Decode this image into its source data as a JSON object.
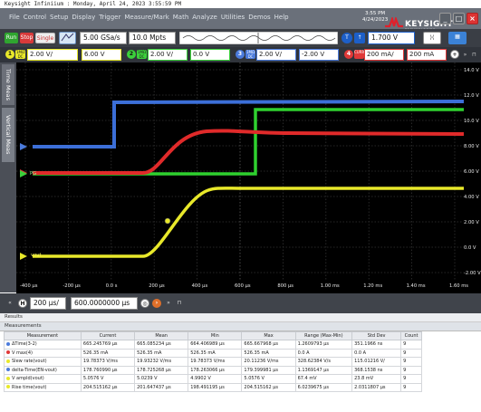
{
  "title_line": "Keysight Infiniium : Monday, April 24, 2023 3:55:59 PM",
  "menu": [
    "File",
    "Control",
    "Setup",
    "Display",
    "Trigger",
    "Measure/Mark",
    "Math",
    "Analyze",
    "Utilities",
    "Demos",
    "Help"
  ],
  "clock": {
    "time": "3:55 PM",
    "date": "4/24/2023"
  },
  "brand": {
    "name": "KEYSIGHT",
    "sub": "TECHNOLOGIES"
  },
  "acq": {
    "run": "Run",
    "stop": "Stop",
    "single": "Single",
    "sample_rate": "5.00 GSa/s",
    "memory": "10.0 Mpts",
    "trigger_level": "1.700 V"
  },
  "channels": [
    {
      "id": "1",
      "scale": "2.00 V/",
      "offset": "6.00 V",
      "color": "#e8e82a"
    },
    {
      "id": "2",
      "scale": "2.00 V/",
      "offset": "0.0 V",
      "color": "#3bd13b"
    },
    {
      "id": "3",
      "scale": "2.00 V/",
      "offset": "-2.00 V",
      "color": "#4b7bdc"
    },
    {
      "id": "4",
      "scale": "200 mA/",
      "offset": "200 mA",
      "color": "#e03838"
    }
  ],
  "sidebar": {
    "tab1": "Time Meas",
    "tab2": "Vertical Meas"
  },
  "y_ticks": [
    "14.0 V",
    "12.0 V",
    "10.0 V",
    "8.00 V",
    "6.00 V",
    "4.00 V",
    "2.00 V",
    "0.0 V",
    "-2.00 V"
  ],
  "x_ticks": [
    "-400 µs",
    "-200 µs",
    "0.0 s",
    "200 µs",
    "400 µs",
    "600 µs",
    "800 µs",
    "1.00 ms",
    "1.20 ms",
    "1.40 ms",
    "1.60 ms"
  ],
  "labels": {
    "pg": "PG",
    "vout": "vout",
    "en": "EN"
  },
  "timebase": {
    "scale": "200 µs/",
    "position": "600.0000000 µs"
  },
  "results": {
    "title": "Results",
    "section": "Measurements",
    "columns": [
      "Measurement",
      "Current",
      "Mean",
      "Min",
      "Max",
      "Range (Max-Min)",
      "Std Dev",
      "Count"
    ],
    "rows": [
      {
        "color": "#4b7bdc",
        "cells": [
          "ΔTime(3-2)",
          "665.245769 µs",
          "665.085234 µs",
          "664.406989 µs",
          "665.667968 µs",
          "1.2609793 µs",
          "351.1966 ns",
          "9"
        ]
      },
      {
        "color": "#e03838",
        "cells": [
          "V max(4)",
          "526.35 mA",
          "526.35 mA",
          "526.35 mA",
          "526.35 mA",
          "0.0 A",
          "0.0 A",
          "9"
        ]
      },
      {
        "color": "#e8e82a",
        "cells": [
          "Slew rate(vout)",
          "19.78373 V/ms",
          "19.93232 V/ms",
          "19.78373 V/ms",
          "20.11236 V/ms",
          "328.62384 V/s",
          "115.01216 V/",
          "9"
        ]
      },
      {
        "color": "#4b7bdc",
        "cells": [
          "delta-Time(EN-vout)",
          "178.760990 µs",
          "178.725268 µs",
          "178.263066 µs",
          "179.399981 µs",
          "1.1369147 µs",
          "368.1538 ns",
          "9"
        ]
      },
      {
        "color": "#e8e82a",
        "cells": [
          "V ampld(vout)",
          "5.0576 V",
          "5.0239 V",
          "4.9902 V",
          "5.0576 V",
          "67.4 mV",
          "23.8 mV",
          "9"
        ]
      },
      {
        "color": "#e8e82a",
        "cells": [
          "Rise time(vout)",
          "204.515162 µs",
          "201.647437 µs",
          "198.491195 µs",
          "204.515162 µs",
          "6.0239675 µs",
          "2.0311807 µs",
          "9"
        ]
      }
    ]
  }
}
